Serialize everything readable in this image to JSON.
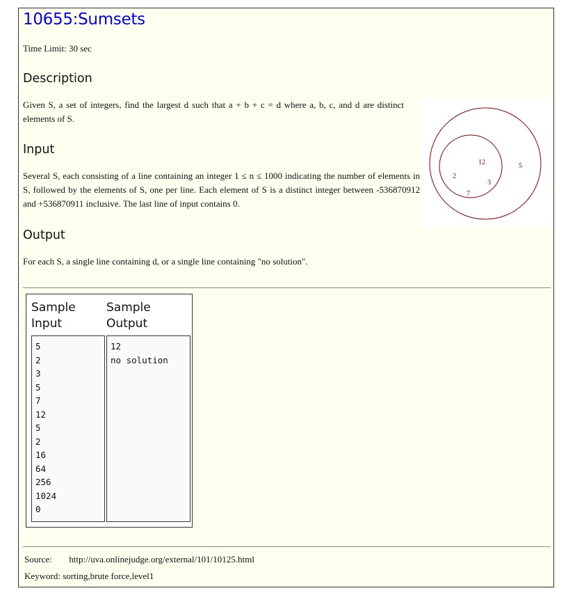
{
  "problem": {
    "title": "10655:Sumsets",
    "time_limit": "Time Limit: 30 sec"
  },
  "description": {
    "heading": "Description",
    "text": "Given S, a set of integers, find the largest d such that a + b + c = d where a, b, c, and d are distinct elements of S."
  },
  "input": {
    "heading": "Input",
    "text": "Several S, each consisting of a line containing an integer 1 ≤ n ≤ 1000 indicating the number of elements in S, followed by the elements of S, one per line. Each element of S is a distinct integer between -536870912 and +536870911 inclusive. The last line of input contains 0."
  },
  "output": {
    "heading": "Output",
    "text": "For each S, a single line containing d, or a single line containing \"no solution\"."
  },
  "figure": {
    "inner_labels": [
      "12",
      "2",
      "3",
      "7"
    ],
    "outer_label": "5",
    "circle_color": "#8b0000"
  },
  "sample": {
    "input_heading": [
      "Sample",
      "Input"
    ],
    "output_heading": [
      "Sample",
      "Output"
    ],
    "input_lines": [
      "5",
      "2",
      "3",
      "5",
      "7",
      "12",
      "5",
      "2",
      "16",
      "64",
      "256",
      "1024",
      "0"
    ],
    "output_lines": [
      "12",
      "no solution"
    ]
  },
  "footer": {
    "source_label": "Source:",
    "source_url": "http://uva.onlinejudge.org/external/101/10125.html",
    "keyword": "Keyword: sorting,brute force,level1"
  },
  "colors": {
    "page_bg": "#fffff0",
    "title": "#0000ee"
  }
}
